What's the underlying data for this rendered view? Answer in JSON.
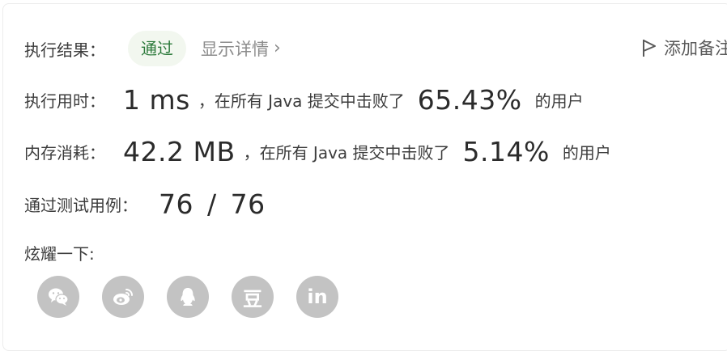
{
  "result": {
    "label": "执行结果：",
    "status": "通过",
    "details": "显示详情",
    "add_note": "添加备注"
  },
  "runtime": {
    "label": "执行用时：",
    "value": "1 ms",
    "prefix": "，在所有 Java 提交中击败了",
    "percent": "65.43%",
    "suffix": "的用户"
  },
  "memory": {
    "label": "内存消耗：",
    "value": "42.2 MB",
    "prefix": "，在所有 Java 提交中击败了",
    "percent": "5.14%",
    "suffix": "的用户"
  },
  "tests": {
    "label": "通过测试用例：",
    "value": "76 / 76"
  },
  "share": {
    "label": "炫耀一下:",
    "icons": [
      "wechat-icon",
      "weibo-icon",
      "qq-icon",
      "douban-icon",
      "linkedin-icon"
    ],
    "douban_text": "豆",
    "linkedin_text": "in"
  }
}
